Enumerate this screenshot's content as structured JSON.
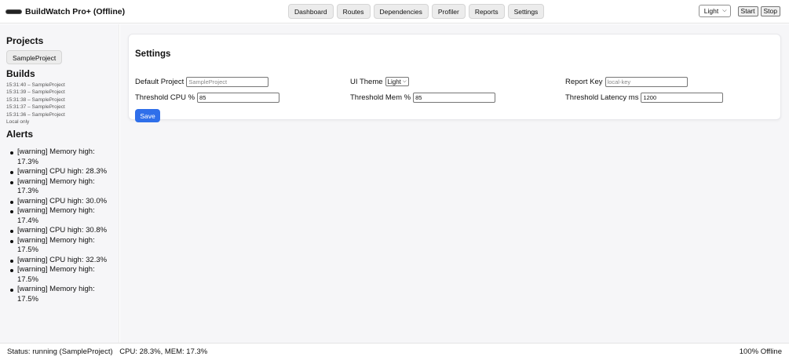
{
  "header": {
    "title": "BuildWatch Pro+ (Offline)",
    "logo_icon": "app-logo",
    "nav": [
      "Dashboard",
      "Routes",
      "Dependencies",
      "Profiler",
      "Reports",
      "Settings"
    ],
    "theme_select": "Light",
    "start_label": "Start",
    "stop_label": "Stop"
  },
  "sidebar": {
    "projects_heading": "Projects",
    "projects": [
      "SampleProject"
    ],
    "builds_heading": "Builds",
    "builds": [
      "15:31:40 – SampleProject",
      "15:31:39 – SampleProject",
      "15:31:38 – SampleProject",
      "15:31:37 – SampleProject",
      "15:31:36 – SampleProject"
    ],
    "builds_note": "Local only",
    "alerts_heading": "Alerts",
    "alerts": [
      "[warning] Memory high: 17.3%",
      "[warning] CPU high: 28.3%",
      "[warning] Memory high: 17.3%",
      "[warning] CPU high: 30.0%",
      "[warning] Memory high: 17.4%",
      "[warning] CPU high: 30.8%",
      "[warning] Memory high: 17.5%",
      "[warning] CPU high: 32.3%",
      "[warning] Memory high: 17.5%",
      "[warning] Memory high: 17.5%"
    ]
  },
  "settings": {
    "title": "Settings",
    "default_project_label": "Default Project",
    "default_project_placeholder": "SampleProject",
    "ui_theme_label": "UI Theme",
    "ui_theme_value": "Light",
    "report_key_label": "Report Key",
    "report_key_placeholder": "local-key",
    "threshold_cpu_label": "Threshold CPU %",
    "threshold_cpu_value": "85",
    "threshold_mem_label": "Threshold Mem %",
    "threshold_mem_value": "85",
    "threshold_latency_label": "Threshold Latency ms",
    "threshold_latency_value": "1200",
    "save_label": "Save"
  },
  "status": {
    "state": "Status: running (SampleProject)",
    "metrics": "CPU: 28.3%, MEM: 17.3%",
    "right": "100% Offline"
  },
  "colors": {
    "accent": "#2f6fea",
    "panel_bg": "#f6f6f8",
    "nav_bg": "#ececec"
  }
}
